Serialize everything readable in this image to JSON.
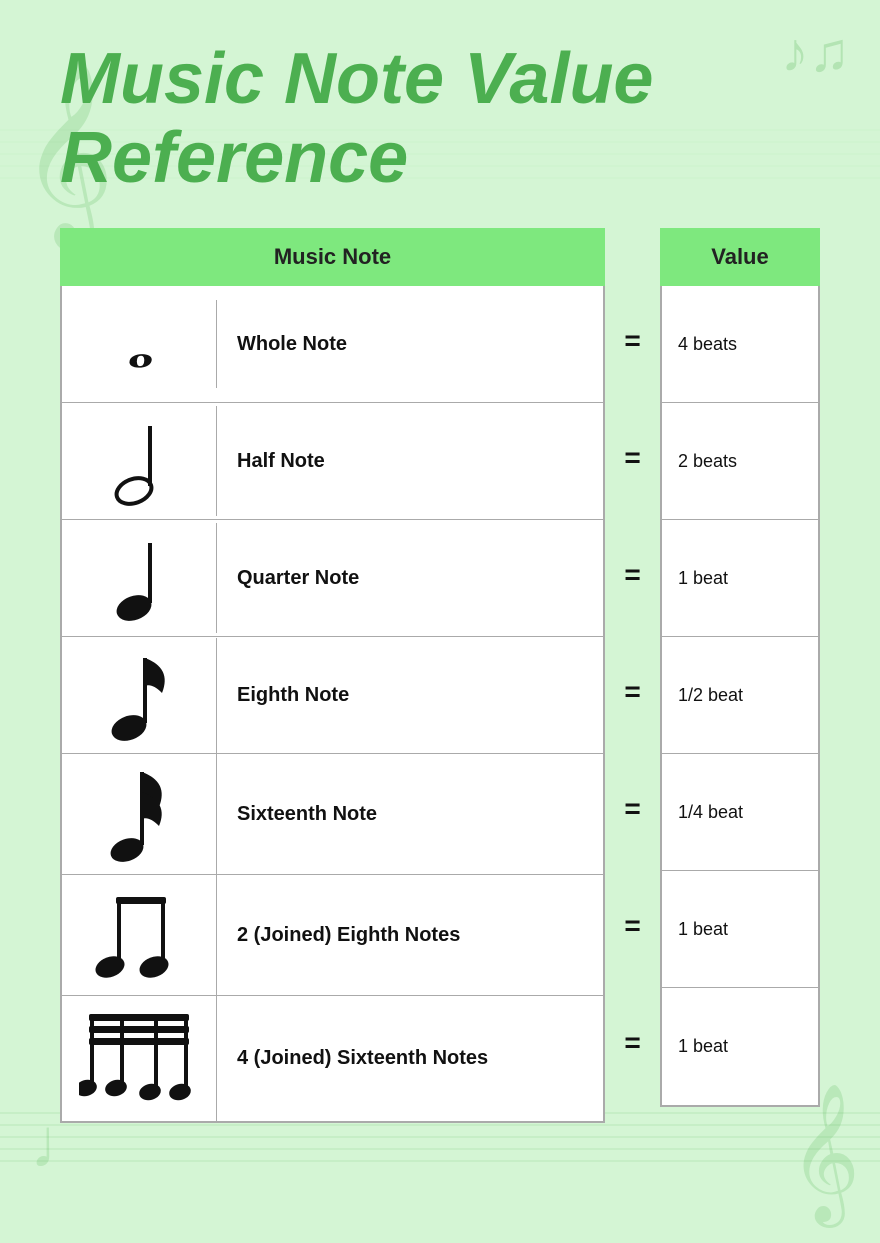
{
  "title": {
    "line1": "Music Note Value",
    "line2": "Reference"
  },
  "columns": {
    "music_note": "Music Note",
    "value": "Value"
  },
  "notes": [
    {
      "name": "Whole Note",
      "value": "4 beats",
      "type": "whole"
    },
    {
      "name": "Half Note",
      "value": "2 beats",
      "type": "half"
    },
    {
      "name": "Quarter Note",
      "value": "1 beat",
      "type": "quarter"
    },
    {
      "name": "Eighth Note",
      "value": "1/2 beat",
      "type": "eighth"
    },
    {
      "name": "Sixteenth Note",
      "value": "1/4 beat",
      "type": "sixteenth"
    },
    {
      "name": "2 (Joined) Eighth Notes",
      "value": "1 beat",
      "type": "joined-eighth"
    },
    {
      "name": "4 (Joined) Sixteenth Notes",
      "value": "1 beat",
      "type": "joined-sixteenth"
    }
  ],
  "equals_symbol": "=",
  "accent_color": "#7ee87e",
  "bg_color": "#d4f5d4"
}
